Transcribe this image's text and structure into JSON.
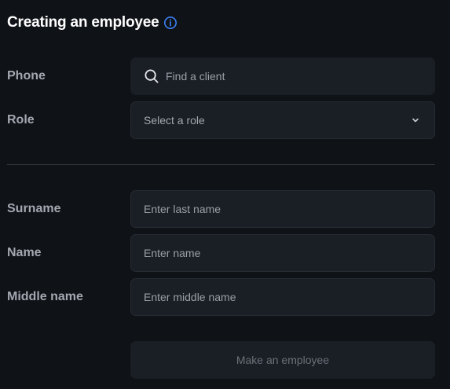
{
  "header": {
    "title": "Creating an employee",
    "info_icon": "info-circle-icon",
    "info_icon_color": "#3b82f6"
  },
  "client_section": {
    "phone": {
      "label": "Phone",
      "placeholder": "Find a client",
      "icon": "search-icon"
    },
    "role": {
      "label": "Role",
      "selected": "Select a role",
      "icon": "chevron-down-icon"
    }
  },
  "employee_section": {
    "surname": {
      "label": "Surname",
      "placeholder": "Enter last name"
    },
    "name": {
      "label": "Name",
      "placeholder": "Enter name"
    },
    "middle_name": {
      "label": "Middle name",
      "placeholder": "Enter middle name"
    }
  },
  "actions": {
    "submit_label": "Make an employee",
    "submit_disabled": true
  },
  "colors": {
    "background": "#0f1217",
    "field_background": "#1a1e25",
    "field_border": "#262b33",
    "label_text": "#a3a8b0",
    "placeholder_text": "#9aa0a8",
    "disabled_text": "#6b7079",
    "divider": "#353a42"
  }
}
